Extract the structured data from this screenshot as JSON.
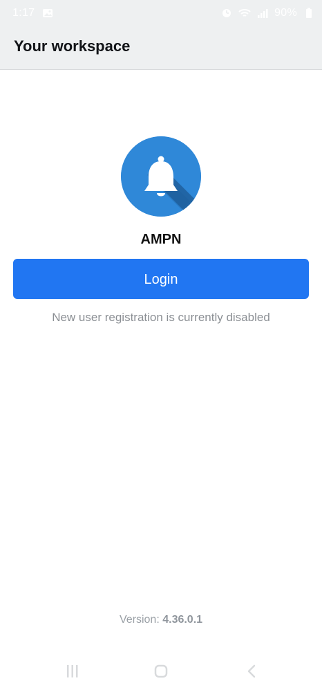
{
  "status_bar": {
    "time": "1:17",
    "battery": "90%",
    "icons": [
      "image-icon",
      "alarm-icon",
      "wifi-icon",
      "signal-icon",
      "battery-icon"
    ]
  },
  "app_bar": {
    "title": "Your workspace"
  },
  "workspace": {
    "logo_icon": "bell-icon",
    "name": "AMPN"
  },
  "login_button": {
    "label": "Login"
  },
  "registration_status": "New user registration is currently disabled",
  "version": {
    "label": "Version: ",
    "number": "4.36.0.1"
  },
  "bottom_nav": {
    "icons": [
      "recent-apps-icon",
      "home-icon",
      "back-icon"
    ]
  },
  "colors": {
    "primary": "#2176f2",
    "logo_bg": "#2f88d8",
    "app_bar_bg": "#eef0f1",
    "muted_text": "#8b8f94"
  }
}
